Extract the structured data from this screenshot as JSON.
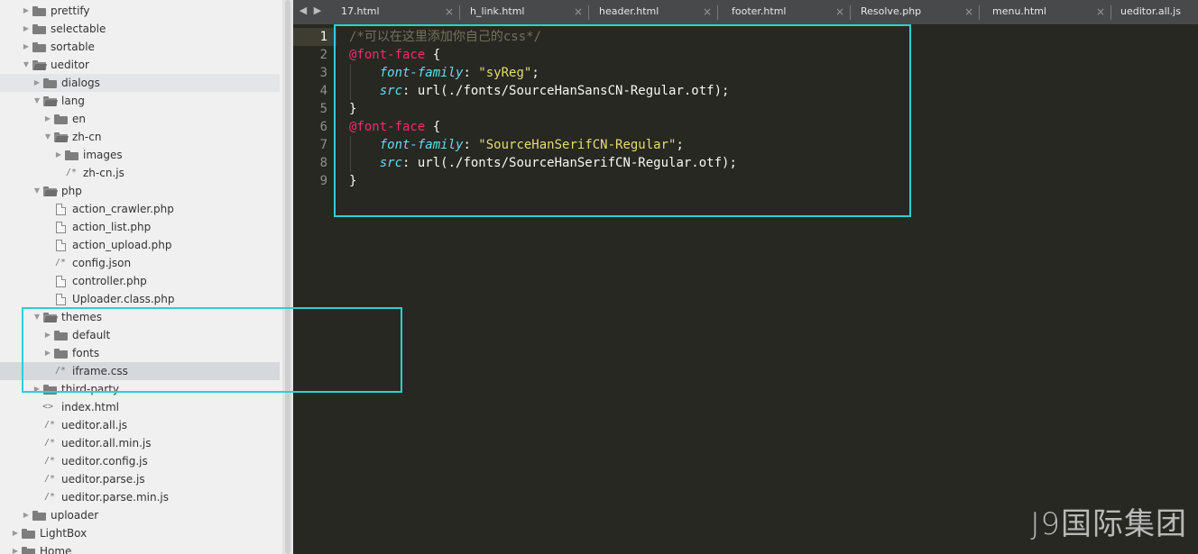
{
  "sidebar": {
    "items": [
      {
        "label": "prettify",
        "type": "folder",
        "depth": 1,
        "state": "closed"
      },
      {
        "label": "selectable",
        "type": "folder",
        "depth": 1,
        "state": "closed"
      },
      {
        "label": "sortable",
        "type": "folder",
        "depth": 1,
        "state": "closed"
      },
      {
        "label": "ueditor",
        "type": "folder",
        "depth": 1,
        "state": "open"
      },
      {
        "label": "dialogs",
        "type": "folder",
        "depth": 2,
        "state": "closed"
      },
      {
        "label": "lang",
        "type": "folder",
        "depth": 2,
        "state": "open"
      },
      {
        "label": "en",
        "type": "folder",
        "depth": 3,
        "state": "closed"
      },
      {
        "label": "zh-cn",
        "type": "folder",
        "depth": 3,
        "state": "open"
      },
      {
        "label": "images",
        "type": "folder",
        "depth": 4,
        "state": "closed"
      },
      {
        "label": "zh-cn.js",
        "type": "script",
        "depth": 4
      },
      {
        "label": "php",
        "type": "folder",
        "depth": 2,
        "state": "open"
      },
      {
        "label": "action_crawler.php",
        "type": "file",
        "depth": 3
      },
      {
        "label": "action_list.php",
        "type": "file",
        "depth": 3
      },
      {
        "label": "action_upload.php",
        "type": "file",
        "depth": 3
      },
      {
        "label": "config.json",
        "type": "script",
        "depth": 3
      },
      {
        "label": "controller.php",
        "type": "file",
        "depth": 3
      },
      {
        "label": "Uploader.class.php",
        "type": "file",
        "depth": 3
      },
      {
        "label": "themes",
        "type": "folder",
        "depth": 2,
        "state": "open"
      },
      {
        "label": "default",
        "type": "folder",
        "depth": 3,
        "state": "closed"
      },
      {
        "label": "fonts",
        "type": "folder",
        "depth": 3,
        "state": "closed"
      },
      {
        "label": "iframe.css",
        "type": "script",
        "depth": 3,
        "selected": true
      },
      {
        "label": "third-party",
        "type": "folder",
        "depth": 2,
        "state": "closed"
      },
      {
        "label": "index.html",
        "type": "code",
        "depth": 2
      },
      {
        "label": "ueditor.all.js",
        "type": "script",
        "depth": 2
      },
      {
        "label": "ueditor.all.min.js",
        "type": "script",
        "depth": 2
      },
      {
        "label": "ueditor.config.js",
        "type": "script",
        "depth": 2
      },
      {
        "label": "ueditor.parse.js",
        "type": "script",
        "depth": 2
      },
      {
        "label": "ueditor.parse.min.js",
        "type": "script",
        "depth": 2
      },
      {
        "label": "uploader",
        "type": "folder",
        "depth": 1,
        "state": "closed"
      },
      {
        "label": "LightBox",
        "type": "folder",
        "depth": 0,
        "state": "closed"
      },
      {
        "label": "Home",
        "type": "folder",
        "depth": 0,
        "state": "closed"
      }
    ]
  },
  "tabs": {
    "nav_arrows": "◀ ▶",
    "close_glyph": "×",
    "items": [
      {
        "label": "17.html"
      },
      {
        "label": "h_link.html"
      },
      {
        "label": "header.html"
      },
      {
        "label": "footer.html"
      },
      {
        "label": "Resolve.php"
      },
      {
        "label": "menu.html"
      },
      {
        "label": "ueditor.all.js"
      }
    ]
  },
  "editor": {
    "current_line": 1,
    "lines": [
      {
        "n": "1",
        "tokens": [
          {
            "t": "/*可以在这里添加你自己的css*/",
            "c": "comment"
          }
        ]
      },
      {
        "n": "2",
        "tokens": [
          {
            "t": "@font-face",
            "c": "at"
          },
          {
            "t": " {",
            "c": "plain"
          }
        ]
      },
      {
        "n": "3",
        "tokens": [
          {
            "t": "    ",
            "c": "plain"
          },
          {
            "t": "font-family",
            "c": "prop"
          },
          {
            "t": ": ",
            "c": "plain"
          },
          {
            "t": "\"syReg\"",
            "c": "str"
          },
          {
            "t": ";",
            "c": "plain"
          }
        ]
      },
      {
        "n": "4",
        "tokens": [
          {
            "t": "    ",
            "c": "plain"
          },
          {
            "t": "src",
            "c": "prop"
          },
          {
            "t": ": url(./fonts/SourceHanSansCN-Regular.otf);",
            "c": "plain"
          }
        ]
      },
      {
        "n": "5",
        "tokens": [
          {
            "t": "}",
            "c": "plain"
          }
        ]
      },
      {
        "n": "6",
        "tokens": [
          {
            "t": "@font-face",
            "c": "at"
          },
          {
            "t": " {",
            "c": "plain"
          }
        ]
      },
      {
        "n": "7",
        "tokens": [
          {
            "t": "    ",
            "c": "plain"
          },
          {
            "t": "font-family",
            "c": "prop"
          },
          {
            "t": ": ",
            "c": "plain"
          },
          {
            "t": "\"SourceHanSerifCN-Regular\"",
            "c": "str"
          },
          {
            "t": ";",
            "c": "plain"
          }
        ]
      },
      {
        "n": "8",
        "tokens": [
          {
            "t": "    ",
            "c": "plain"
          },
          {
            "t": "src",
            "c": "prop"
          },
          {
            "t": ": url(./fonts/SourceHanSerifCN-Regular.otf);",
            "c": "plain"
          }
        ]
      },
      {
        "n": "9",
        "tokens": [
          {
            "t": "}",
            "c": "plain"
          }
        ]
      }
    ]
  },
  "colors": {
    "editor_bg": "#272822",
    "comment": "#75715e",
    "at_rule": "#f92672",
    "property": "#66d9ef",
    "string": "#e6db74",
    "highlight_box": "#2ecfd4"
  },
  "watermark": "J9国际集团"
}
